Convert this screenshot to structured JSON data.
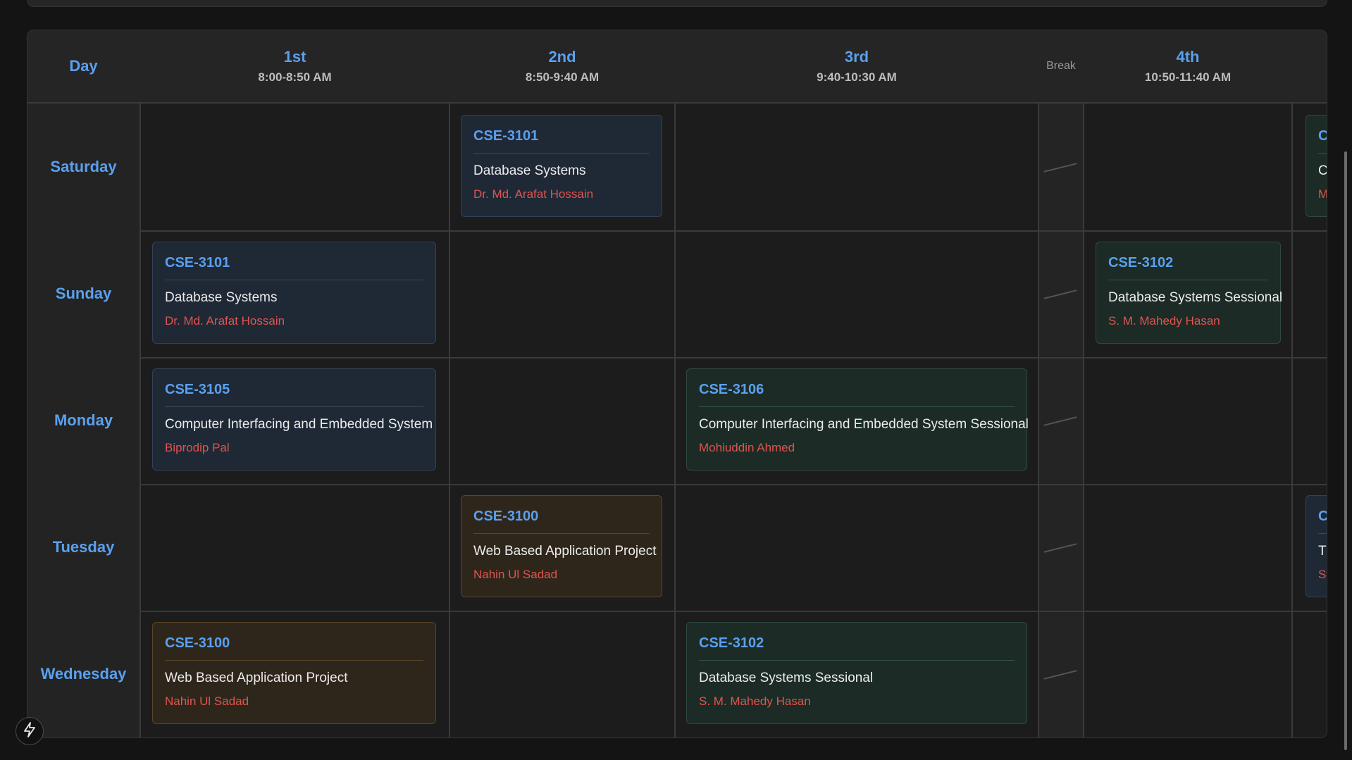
{
  "header": {
    "day_label": "Day",
    "periods": [
      {
        "label": "1st",
        "time": "8:00-8:50 AM"
      },
      {
        "label": "2nd",
        "time": "8:50-9:40 AM"
      },
      {
        "label": "3rd",
        "time": "9:40-10:30 AM"
      },
      {
        "label": "4th",
        "time": "10:50-11:40 AM"
      }
    ],
    "break_label": "Break"
  },
  "days": [
    "Saturday",
    "Sunday",
    "Monday",
    "Tuesday",
    "Wednesday"
  ],
  "classes": {
    "sat_2nd": {
      "code": "CSE-3101",
      "name": "Database Systems",
      "teacher": "Dr. Md. Arafat Hossain"
    },
    "sat_5th": {
      "code": "C",
      "name": "C",
      "teacher": "M"
    },
    "sun_1st": {
      "code": "CSE-3101",
      "name": "Database Systems",
      "teacher": "Dr. Md. Arafat Hossain"
    },
    "sun_4th": {
      "code": "CSE-3102",
      "name": "Database Systems Sessional",
      "teacher": "S. M. Mahedy Hasan"
    },
    "mon_1st": {
      "code": "CSE-3105",
      "name": "Computer Interfacing and Embedded System",
      "teacher": "Biprodip Pal"
    },
    "mon_3rd": {
      "code": "CSE-3106",
      "name": "Computer Interfacing and Embedded System Sessional",
      "teacher": "Mohiuddin Ahmed"
    },
    "tue_2nd": {
      "code": "CSE-3100",
      "name": "Web Based Application Project",
      "teacher": "Nahin Ul Sadad"
    },
    "tue_5th": {
      "code": "C",
      "name": "Tl",
      "teacher": "Sy"
    },
    "wed_1st": {
      "code": "CSE-3100",
      "name": "Web Based Application Project",
      "teacher": "Nahin Ul Sadad"
    },
    "wed_3rd": {
      "code": "CSE-3102",
      "name": "Database Systems Sessional",
      "teacher": "S. M. Mahedy Hasan"
    }
  },
  "icons": {
    "fab": "lightning-bolt-icon"
  },
  "colors": {
    "accent_blue": "#5aa0ee",
    "teacher_red": "#e0544f",
    "card_blue": "#1f2835",
    "card_green": "#1c2b25",
    "card_brown": "#2e261b"
  }
}
